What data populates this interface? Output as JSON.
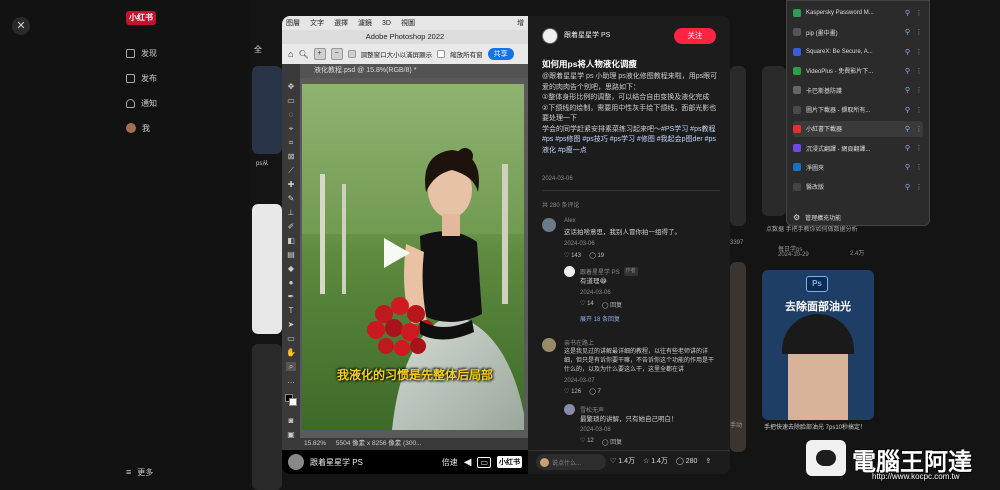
{
  "bg": {
    "logo": "小红书",
    "nav": [
      {
        "label": "发现",
        "icon": "home-icon"
      },
      {
        "label": "发布",
        "icon": "publish-icon"
      },
      {
        "label": "通知",
        "icon": "bell-icon"
      },
      {
        "label": "我",
        "icon": "avatar-icon"
      }
    ],
    "more": "更多",
    "chip_all": "全",
    "card_left_text": "ps从",
    "card_right1_text": "点数据 手把手教你如何做数据分析",
    "card_right1_meta": "每日学ps",
    "card_right1_date": "2024-10-29",
    "card_right1_likes": "2.4万",
    "card_right2_title": "去除面部油光",
    "card_right2_badge": "Ps",
    "card_right2_desc": "手把快速去除脸部油光 7ps10秒搞定！",
    "num_3397": "3397",
    "word_shou": "手动"
  },
  "photoshop": {
    "menu": [
      "图層",
      "文字",
      "選擇",
      "濾鏡",
      "3D",
      "視圖"
    ],
    "menu_more": "增",
    "title": "Adobe Photoshop 2022",
    "opt_resize": "調整窗口大小以滿屏顯示",
    "opt_zoom_all": "縮放所有窗",
    "share": "共享",
    "tab": "液化教程.psd @ 15.8%(RGB/8) *",
    "status_zoom": "15.82%",
    "status_doc": "5504 像素 x 8256 像素 (300...",
    "subtitle": "我液化的习惯是先整体后局部"
  },
  "media_bar": {
    "author": "跟着星星学 PS",
    "speed": "倍速",
    "brand": "小红书"
  },
  "post": {
    "author": "跟着星星学 PS",
    "follow": "关注",
    "title": "如何用ps将人物液化调瘦",
    "body1": "@跟着星星学 ps 小助理 ps液化修图教程来啦，用ps眼可爱的肉肉告个别吧，思路如下：",
    "body2": "①整体身形比例的调整，可以结合自由变换及液化完成",
    "body3": "②下颌线的绘制，需要用中性灰手绘下颌线，面部光影也要处理一下",
    "body4": "学会的同学赶紧安排素菜练习起来吧～",
    "tags1": "#PS学习 #ps教程",
    "tags2": "#ps #ps修图 #ps技巧 #ps学习 #修图 #我起会p图der #ps液化 #p瘦一点",
    "date": "2024-03-06",
    "comment_count": "共 280 条评论"
  },
  "comments": [
    {
      "user": "Alex",
      "text": "这话拍啥意思，我别人冒你拍一组得了。",
      "date": "2024-03-06",
      "likes": "143",
      "replies": "19"
    },
    {
      "user": "跟着星星学 PS",
      "badge": "作者",
      "text": "有道理😂",
      "date": "2024-03-06",
      "likes": "14",
      "reply": "回复",
      "expand": "展开 18 条回复"
    },
    {
      "user": "亲书在路上",
      "text": "这是我见过的讲解最详细的教程，以往有些老师讲的详细，但只是有诉你要干嘛，不告诉你这个功能的作用是干什么的，以及为什么要这么干，这里全都在讲",
      "date": "2024-03-07",
      "likes": "126",
      "replies": "7"
    },
    {
      "user": "雪松无声",
      "text": "最繁琐的讲解，只有她自己明白！",
      "date": "2024-03-08",
      "likes": "12",
      "reply": "回复"
    }
  ],
  "footer": {
    "placeholder": "说点什么...",
    "likes": "1.4万",
    "stars": "1.4万",
    "comments": "280"
  },
  "extensions": [
    {
      "name": "Kaspersky Password M...",
      "color": "#2d9c5a"
    },
    {
      "name": "pip (畫中畫)",
      "color": "#555555"
    },
    {
      "name": "SquareX: Be Secure, A...",
      "color": "#3b5bdb"
    },
    {
      "name": "VideoPlus - 免費影片下...",
      "color": "#2f9e44"
    },
    {
      "name": "卡巴斯基防護",
      "color": "#666666"
    },
    {
      "name": "圖片下載器 - 擷取所有...",
      "color": "#4a4a4a"
    },
    {
      "name": "小紅書下載器",
      "color": "#e03131"
    },
    {
      "name": "沉浸式翻譯 - 網頁翻譯...",
      "color": "#7048e8"
    },
    {
      "name": "淨圖夾",
      "color": "#1971c2"
    },
    {
      "name": "醫改版",
      "color": "#444444"
    }
  ],
  "ext_manage": "管理擴充功能",
  "watermark": {
    "title": "電腦王阿達",
    "url": "http://www.kocpc.com.tw"
  }
}
